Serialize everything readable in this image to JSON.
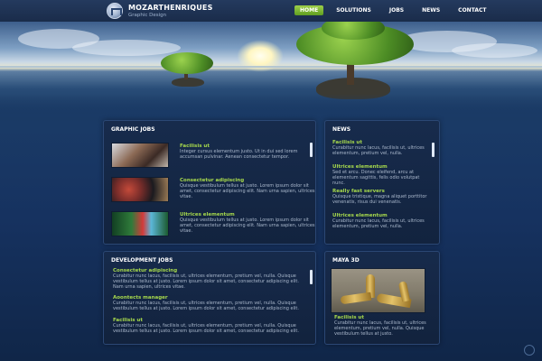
{
  "header": {
    "brand": "MOZARTHENRIQUES",
    "tagline": "Graphic Design",
    "nav": [
      "HOME",
      "SOLUTIONS",
      "JOBS",
      "NEWS",
      "CONTACT"
    ]
  },
  "colors": {
    "accent": "#8cc63f",
    "title": "#ffffff",
    "background": "#1a3a66"
  },
  "graphic_jobs": {
    "title": "GRAPHIC JOBS",
    "items": [
      {
        "title": "Facilisis ut",
        "text": "Integer cursus elementum justo. Ut in dui sed lorem accumsan pulvinar. Aenean consectetur tempor."
      },
      {
        "title": "Consectetur adipiscing",
        "text": "Quisque vestibulum tellus at justo. Lorem ipsum dolor sit amet, consectetur adipiscing elit. Nam urna sapien, ultrices vitae."
      },
      {
        "title": "Ultrices elementum",
        "text": "Quisque vestibulum tellus at justo. Lorem ipsum dolor sit amet, consectetur adipiscing elit. Nam urna sapien, ultrices vitae."
      }
    ]
  },
  "news": {
    "title": "NEWS",
    "items": [
      {
        "title": "Facilisis ut",
        "text": "Curabitur nunc lacus, facilisis ut, ultrices elementum, pretium vel, nulla."
      },
      {
        "title": "Ultrices elementum",
        "text": "Sed et arcu. Donec eleifend, arcu at elementum sagittis, felis odio volutpat nunc."
      },
      {
        "title": "Really fast servers",
        "text": "Quisque tristique, magna aliquet porttitor venenatis, risus dui venenatis."
      },
      {
        "title": "Ultrices elementum",
        "text": "Curabitur nunc lacus, facilisis ut, ultrices elementum, pretium vel, nulla."
      }
    ]
  },
  "development_jobs": {
    "title": "DEVELOPMENT JOBS",
    "items": [
      {
        "title": "Consectetur adipiscing",
        "text": "Curabitur nunc lacus, facilisis ut, ultrices elementum, pretium vel, nulla. Quisque vestibulum tellus at justo. Lorem ipsum dolor sit amet, consectetur adipiscing elit. Nam urna sapien, ultrices vitae."
      },
      {
        "title": "Aoontects manager",
        "text": "Curabitur nunc lacus, facilisis ut, ultrices elementum, pretium vel, nulla. Quisque vestibulum tellus at justo. Lorem ipsum dolor sit amet, consectetur adipiscing elit."
      },
      {
        "title": "Facilisis ut",
        "text": "Curabitur nunc lacus, facilisis ut, ultrices elementum, pretium vel, nulla. Quisque vestibulum tellus at justo. Lorem ipsum dolor sit amet, consectetur adipiscing elit."
      }
    ]
  },
  "maya": {
    "title": "MAYA 3D",
    "item": {
      "title": "Facilisis ut",
      "text": "Curabitur nunc lacus, facilisis ut, ultrices elementum, pretium vel, nulla. Quisque vestibulum tellus at justo."
    }
  }
}
